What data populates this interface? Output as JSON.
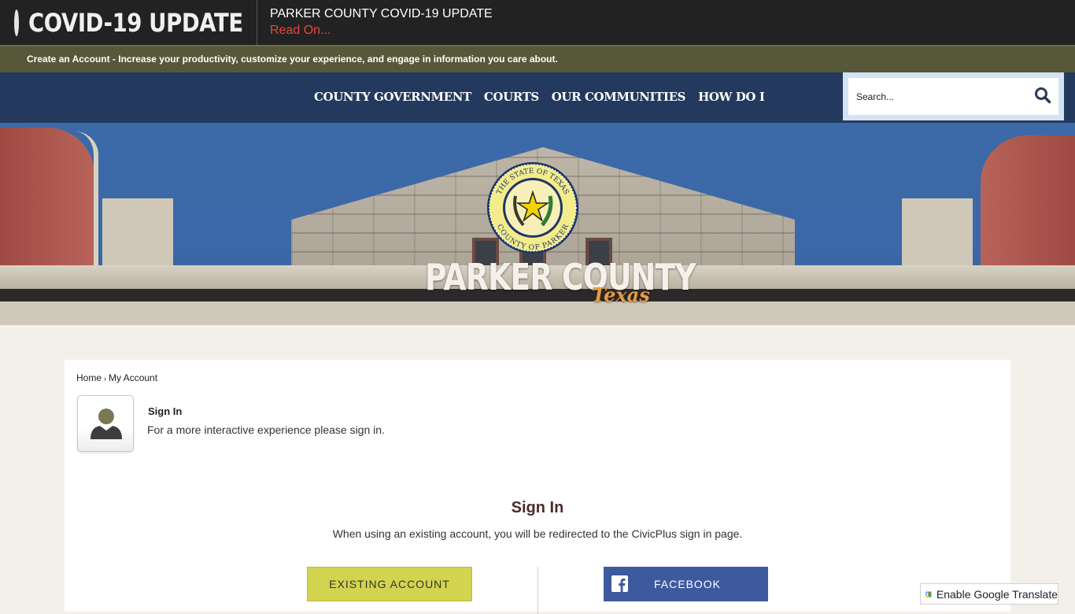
{
  "covid_banner": {
    "title": "COVID-19 UPDATE",
    "headline": "PARKER COUNTY COVID-19 UPDATE",
    "link_label": "Read On..."
  },
  "account_bar": {
    "text": "Create an Account - Increase your productivity, customize your experience, and engage in information you care about."
  },
  "nav": {
    "items": [
      {
        "label": "COUNTY GOVERNMENT"
      },
      {
        "label": "COURTS"
      },
      {
        "label": "OUR COMMUNITIES"
      },
      {
        "label": "HOW DO I"
      }
    ]
  },
  "search": {
    "placeholder": "Search...",
    "value": "",
    "icon": "search-icon"
  },
  "hero": {
    "seal_top_text": "THE STATE OF TEXAS",
    "seal_bottom_text": "COUNTY OF PARKER",
    "brand_name": "PARKER COUNTY",
    "brand_sub": "Texas"
  },
  "breadcrumb": {
    "items": [
      {
        "label": "Home"
      },
      {
        "label": "My Account"
      }
    ],
    "separator": "›"
  },
  "signin_intro": {
    "title": "Sign In",
    "description": "For a more interactive experience please sign in.",
    "icon": "user-avatar-icon"
  },
  "signin_main": {
    "title": "Sign In",
    "description": "When using an existing account, you will be redirected to the CivicPlus sign in page.",
    "existing_account_label": "EXISTING ACCOUNT",
    "facebook_label": "FACEBOOK"
  },
  "translate": {
    "label": "Enable Google Translate"
  },
  "colors": {
    "covid_bg": "#222222",
    "read_on": "#e8473a",
    "account_bar": "#575839",
    "nav_band": "#223658",
    "existing_button": "#d2d44f",
    "facebook_button": "#3e5a9e",
    "signin_title": "#4a2c28",
    "page_bg": "#f3f0e9"
  }
}
